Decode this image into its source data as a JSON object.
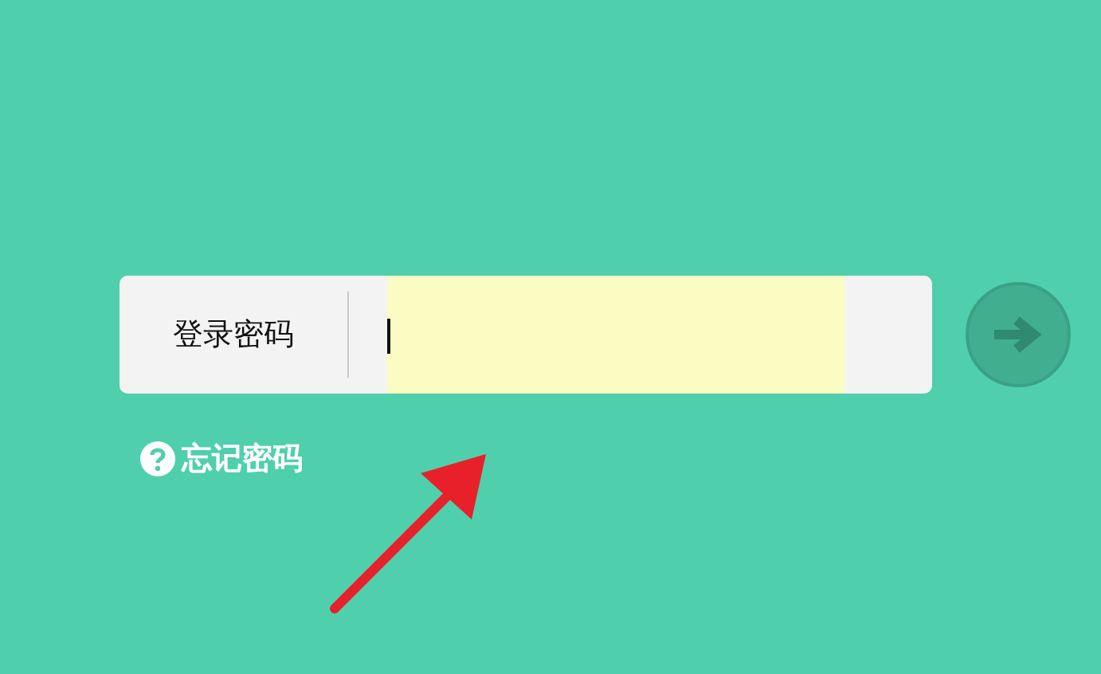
{
  "password_row": {
    "label": "登录密码"
  },
  "forgot_link": "忘记密码"
}
